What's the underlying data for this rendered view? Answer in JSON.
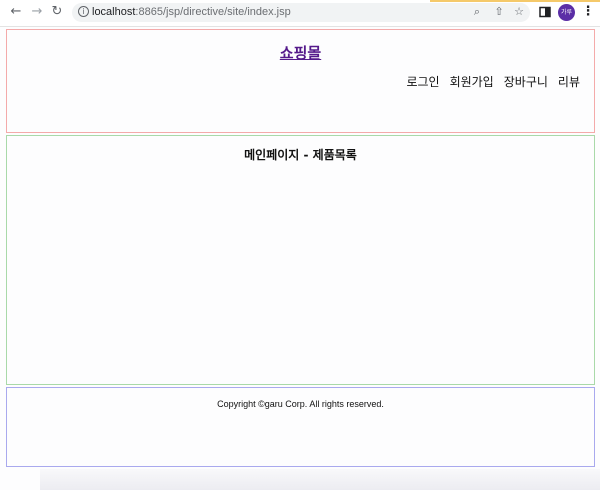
{
  "browser": {
    "url_host": "localhost",
    "url_path": ":8865/jsp/directive/site/index.jsp",
    "profile_label": "가루",
    "icons": {
      "back": "arrow-left-icon",
      "forward": "arrow-right-icon",
      "reload": "reload-icon",
      "site_info": "info-icon",
      "zoom": "magnifier-icon",
      "share": "share-icon",
      "bookmark": "star-icon",
      "side_panel": "side-panel-icon",
      "menu": "kebab-menu-icon"
    }
  },
  "header": {
    "title": "쇼핑몰",
    "menu": [
      "로그인",
      "회원가입",
      "장바구니",
      "리뷰"
    ]
  },
  "main": {
    "heading": "메인페이지 - 제품목록"
  },
  "footer": {
    "copyright": "Copyright ©garu Corp. All rights reserved."
  },
  "colors": {
    "header_border": "#f4aaaa",
    "main_border": "#a9d9a9",
    "footer_border": "#a9a9ee",
    "link_visited": "#551a8b",
    "avatar": "#5b2ea6"
  }
}
